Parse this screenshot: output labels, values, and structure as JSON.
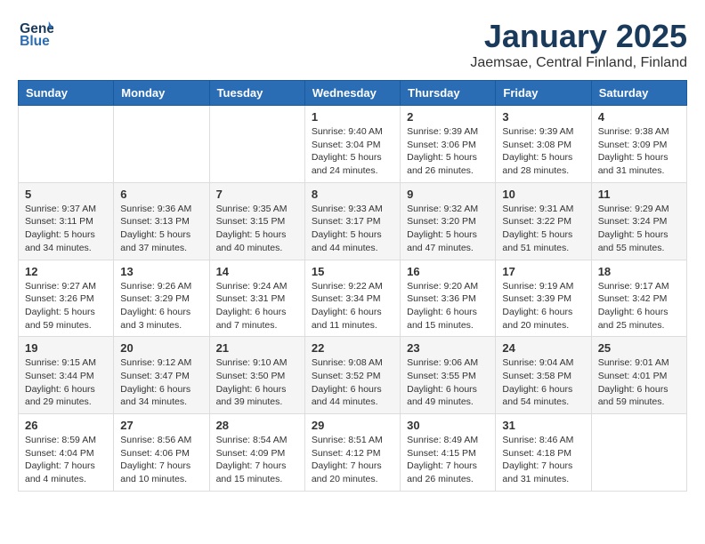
{
  "logo": {
    "line1": "General",
    "line2": "Blue"
  },
  "title": "January 2025",
  "subtitle": "Jaemsae, Central Finland, Finland",
  "weekdays": [
    "Sunday",
    "Monday",
    "Tuesday",
    "Wednesday",
    "Thursday",
    "Friday",
    "Saturday"
  ],
  "weeks": [
    [
      {
        "day": "",
        "info": ""
      },
      {
        "day": "",
        "info": ""
      },
      {
        "day": "",
        "info": ""
      },
      {
        "day": "1",
        "info": "Sunrise: 9:40 AM\nSunset: 3:04 PM\nDaylight: 5 hours\nand 24 minutes."
      },
      {
        "day": "2",
        "info": "Sunrise: 9:39 AM\nSunset: 3:06 PM\nDaylight: 5 hours\nand 26 minutes."
      },
      {
        "day": "3",
        "info": "Sunrise: 9:39 AM\nSunset: 3:08 PM\nDaylight: 5 hours\nand 28 minutes."
      },
      {
        "day": "4",
        "info": "Sunrise: 9:38 AM\nSunset: 3:09 PM\nDaylight: 5 hours\nand 31 minutes."
      }
    ],
    [
      {
        "day": "5",
        "info": "Sunrise: 9:37 AM\nSunset: 3:11 PM\nDaylight: 5 hours\nand 34 minutes."
      },
      {
        "day": "6",
        "info": "Sunrise: 9:36 AM\nSunset: 3:13 PM\nDaylight: 5 hours\nand 37 minutes."
      },
      {
        "day": "7",
        "info": "Sunrise: 9:35 AM\nSunset: 3:15 PM\nDaylight: 5 hours\nand 40 minutes."
      },
      {
        "day": "8",
        "info": "Sunrise: 9:33 AM\nSunset: 3:17 PM\nDaylight: 5 hours\nand 44 minutes."
      },
      {
        "day": "9",
        "info": "Sunrise: 9:32 AM\nSunset: 3:20 PM\nDaylight: 5 hours\nand 47 minutes."
      },
      {
        "day": "10",
        "info": "Sunrise: 9:31 AM\nSunset: 3:22 PM\nDaylight: 5 hours\nand 51 minutes."
      },
      {
        "day": "11",
        "info": "Sunrise: 9:29 AM\nSunset: 3:24 PM\nDaylight: 5 hours\nand 55 minutes."
      }
    ],
    [
      {
        "day": "12",
        "info": "Sunrise: 9:27 AM\nSunset: 3:26 PM\nDaylight: 5 hours\nand 59 minutes."
      },
      {
        "day": "13",
        "info": "Sunrise: 9:26 AM\nSunset: 3:29 PM\nDaylight: 6 hours\nand 3 minutes."
      },
      {
        "day": "14",
        "info": "Sunrise: 9:24 AM\nSunset: 3:31 PM\nDaylight: 6 hours\nand 7 minutes."
      },
      {
        "day": "15",
        "info": "Sunrise: 9:22 AM\nSunset: 3:34 PM\nDaylight: 6 hours\nand 11 minutes."
      },
      {
        "day": "16",
        "info": "Sunrise: 9:20 AM\nSunset: 3:36 PM\nDaylight: 6 hours\nand 15 minutes."
      },
      {
        "day": "17",
        "info": "Sunrise: 9:19 AM\nSunset: 3:39 PM\nDaylight: 6 hours\nand 20 minutes."
      },
      {
        "day": "18",
        "info": "Sunrise: 9:17 AM\nSunset: 3:42 PM\nDaylight: 6 hours\nand 25 minutes."
      }
    ],
    [
      {
        "day": "19",
        "info": "Sunrise: 9:15 AM\nSunset: 3:44 PM\nDaylight: 6 hours\nand 29 minutes."
      },
      {
        "day": "20",
        "info": "Sunrise: 9:12 AM\nSunset: 3:47 PM\nDaylight: 6 hours\nand 34 minutes."
      },
      {
        "day": "21",
        "info": "Sunrise: 9:10 AM\nSunset: 3:50 PM\nDaylight: 6 hours\nand 39 minutes."
      },
      {
        "day": "22",
        "info": "Sunrise: 9:08 AM\nSunset: 3:52 PM\nDaylight: 6 hours\nand 44 minutes."
      },
      {
        "day": "23",
        "info": "Sunrise: 9:06 AM\nSunset: 3:55 PM\nDaylight: 6 hours\nand 49 minutes."
      },
      {
        "day": "24",
        "info": "Sunrise: 9:04 AM\nSunset: 3:58 PM\nDaylight: 6 hours\nand 54 minutes."
      },
      {
        "day": "25",
        "info": "Sunrise: 9:01 AM\nSunset: 4:01 PM\nDaylight: 6 hours\nand 59 minutes."
      }
    ],
    [
      {
        "day": "26",
        "info": "Sunrise: 8:59 AM\nSunset: 4:04 PM\nDaylight: 7 hours\nand 4 minutes."
      },
      {
        "day": "27",
        "info": "Sunrise: 8:56 AM\nSunset: 4:06 PM\nDaylight: 7 hours\nand 10 minutes."
      },
      {
        "day": "28",
        "info": "Sunrise: 8:54 AM\nSunset: 4:09 PM\nDaylight: 7 hours\nand 15 minutes."
      },
      {
        "day": "29",
        "info": "Sunrise: 8:51 AM\nSunset: 4:12 PM\nDaylight: 7 hours\nand 20 minutes."
      },
      {
        "day": "30",
        "info": "Sunrise: 8:49 AM\nSunset: 4:15 PM\nDaylight: 7 hours\nand 26 minutes."
      },
      {
        "day": "31",
        "info": "Sunrise: 8:46 AM\nSunset: 4:18 PM\nDaylight: 7 hours\nand 31 minutes."
      },
      {
        "day": "",
        "info": ""
      }
    ]
  ]
}
